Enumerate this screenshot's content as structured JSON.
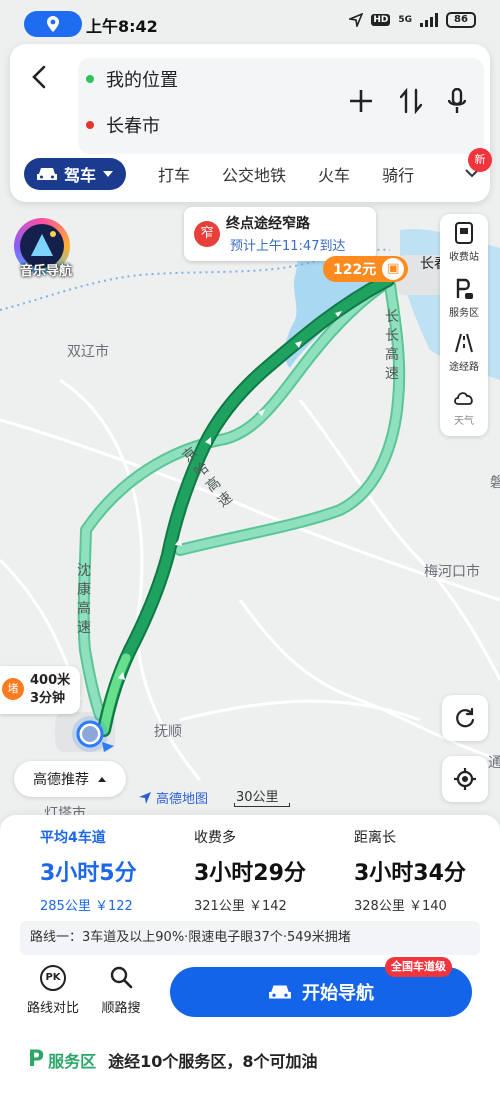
{
  "status_bar": {
    "time": "上午8:42",
    "hd": "HD",
    "network": "5G",
    "battery": "86"
  },
  "search": {
    "back_icon": "back-arrow-icon",
    "origin": "我的位置",
    "destination": "长春市",
    "colors": {
      "origin": "#2bc45a",
      "destination": "#e8352d"
    }
  },
  "modes": {
    "active": "驾车",
    "tabs": [
      "打车",
      "公交地铁",
      "火车",
      "骑行"
    ],
    "new_badge": "新"
  },
  "music_nav": {
    "label": "音乐导航"
  },
  "map": {
    "places": [
      "双辽市",
      "抚顺",
      "梅河口市",
      "长春",
      "灯塔市",
      "磐",
      "通"
    ],
    "roads": [
      "京哈高速",
      "沈康高速",
      "长长高速"
    ],
    "narrow_alert": {
      "icon": "窄",
      "title": "终点途经窄路",
      "subtitle": "预计上午11:47到达"
    },
    "toll_pin": "122元",
    "jam": {
      "icon": "堵",
      "distance": "400米",
      "duration": "3分钟"
    },
    "scale": "30公里",
    "logo": "高德地图"
  },
  "tools": [
    {
      "label": "收费站",
      "icon": "toll-station-icon"
    },
    {
      "label": "服务区",
      "icon": "service-area-icon"
    },
    {
      "label": "途经路",
      "icon": "via-road-icon"
    },
    {
      "label": "天气",
      "icon": "weather-icon"
    }
  ],
  "recommend": {
    "label": "高德推荐"
  },
  "routes": [
    {
      "tag": "平均4车道",
      "time": "3小时5分",
      "meta": "285公里 ￥122",
      "selected": true
    },
    {
      "tag": "收费多",
      "time": "3小时29分",
      "meta": "321公里 ￥142",
      "selected": false
    },
    {
      "tag": "距离长",
      "time": "3小时34分",
      "meta": "328公里 ￥140",
      "selected": false
    }
  ],
  "route_desc": "路线一：3车道及以上90%·限速电子眼37个·549米拥堵",
  "actions": {
    "compare": {
      "icon": "PK",
      "label": "路线对比"
    },
    "search": {
      "label": "顺路搜"
    }
  },
  "start": {
    "label": "开始导航",
    "badge": "全国车道级"
  },
  "service": {
    "icon": "P",
    "label": "服务区",
    "text": "途经10个服务区，8个可加油"
  },
  "colors": {
    "primary": "#1464ea",
    "route_main": "#1a9a58",
    "route_alt": "#6fd3ac",
    "water": "#a9d8f2"
  }
}
